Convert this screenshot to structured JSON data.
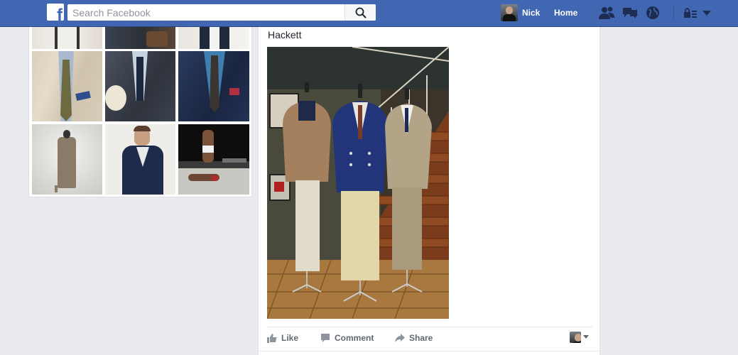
{
  "search": {
    "placeholder": "Search Facebook"
  },
  "nav": {
    "user_name": "Nick",
    "home_label": "Home"
  },
  "post": {
    "title": "Hackett"
  },
  "actions": {
    "like": "Like",
    "comment": "Comment",
    "share": "Share"
  },
  "icons": {
    "logo": "facebook-logo-icon",
    "search": "search-icon",
    "friends": "friend-requests-icon",
    "messages": "messages-icon",
    "notifications": "notifications-globe-icon",
    "privacy": "privacy-shortcuts-icon",
    "menu": "account-menu-caret-icon"
  },
  "colors": {
    "brand": "#4267b2",
    "page_bg": "#e9ebee",
    "action_text": "#616770"
  }
}
